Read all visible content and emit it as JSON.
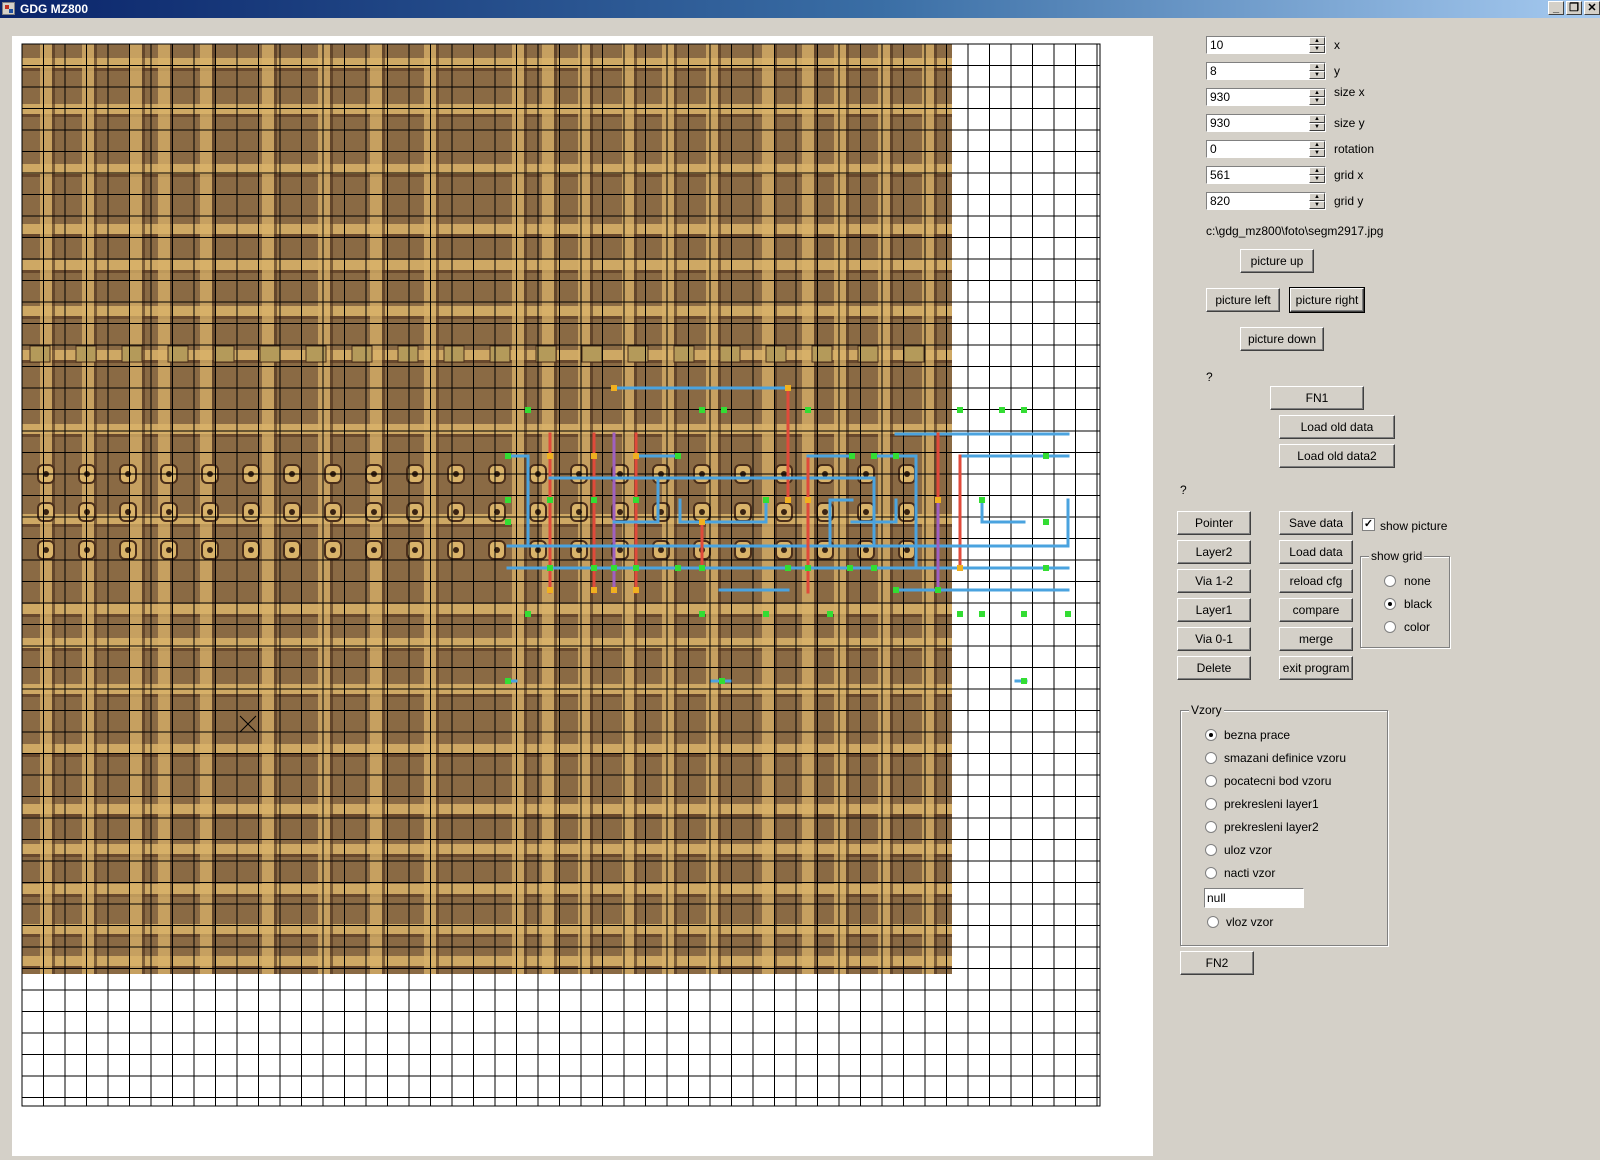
{
  "window": {
    "title": "GDG MZ800",
    "min_glyph": "_",
    "max_glyph": "❐",
    "close_glyph": "✕"
  },
  "fields": [
    {
      "label": "x",
      "value": "10"
    },
    {
      "label": "y",
      "value": "8"
    },
    {
      "label": "size x",
      "value": "930"
    },
    {
      "label": "size y",
      "value": "930"
    },
    {
      "label": "rotation",
      "value": "0"
    },
    {
      "label": "grid x",
      "value": "561"
    },
    {
      "label": "grid y",
      "value": "820"
    }
  ],
  "picture_path": "c:\\gdg_mz800\\foto\\segm2917.jpg",
  "nav": {
    "up": "picture up",
    "left": "picture left",
    "right": "picture right",
    "down": "picture down"
  },
  "question1": "?",
  "question2": "?",
  "fn1": "FN1",
  "load_old_data": "Load old data",
  "load_old_data2": "Load old data2",
  "tools": [
    "Pointer",
    "Layer2",
    "Via 1-2",
    "Layer1",
    "Via 0-1",
    "Delete"
  ],
  "actions": [
    "Save data",
    "Load data",
    "reload cfg",
    "compare",
    "merge",
    "exit program"
  ],
  "show_picture": {
    "label": "show picture",
    "checked": true
  },
  "show_grid": {
    "legend": "show grid",
    "options": [
      "none",
      "black",
      "color"
    ],
    "selected": "black"
  },
  "vzory": {
    "legend": "Vzory",
    "options": [
      "bezna prace",
      "smazani definice vzoru",
      "pocatecni bod vzoru",
      "prekresleni layer1",
      "prekresleni layer2",
      "uloz vzor",
      "nacti vzor"
    ],
    "selected": "bezna prace",
    "input_value": "null",
    "last_option": "vloz vzor"
  },
  "fn2": "FN2",
  "colors": {
    "layer1": "#4aa3df",
    "layer2": "#e04a3a",
    "via": "#33dd33",
    "via_dot": "#f0b020",
    "purple": "#a060c0",
    "die": "#8a6a44",
    "metal": "#d9b36a"
  }
}
